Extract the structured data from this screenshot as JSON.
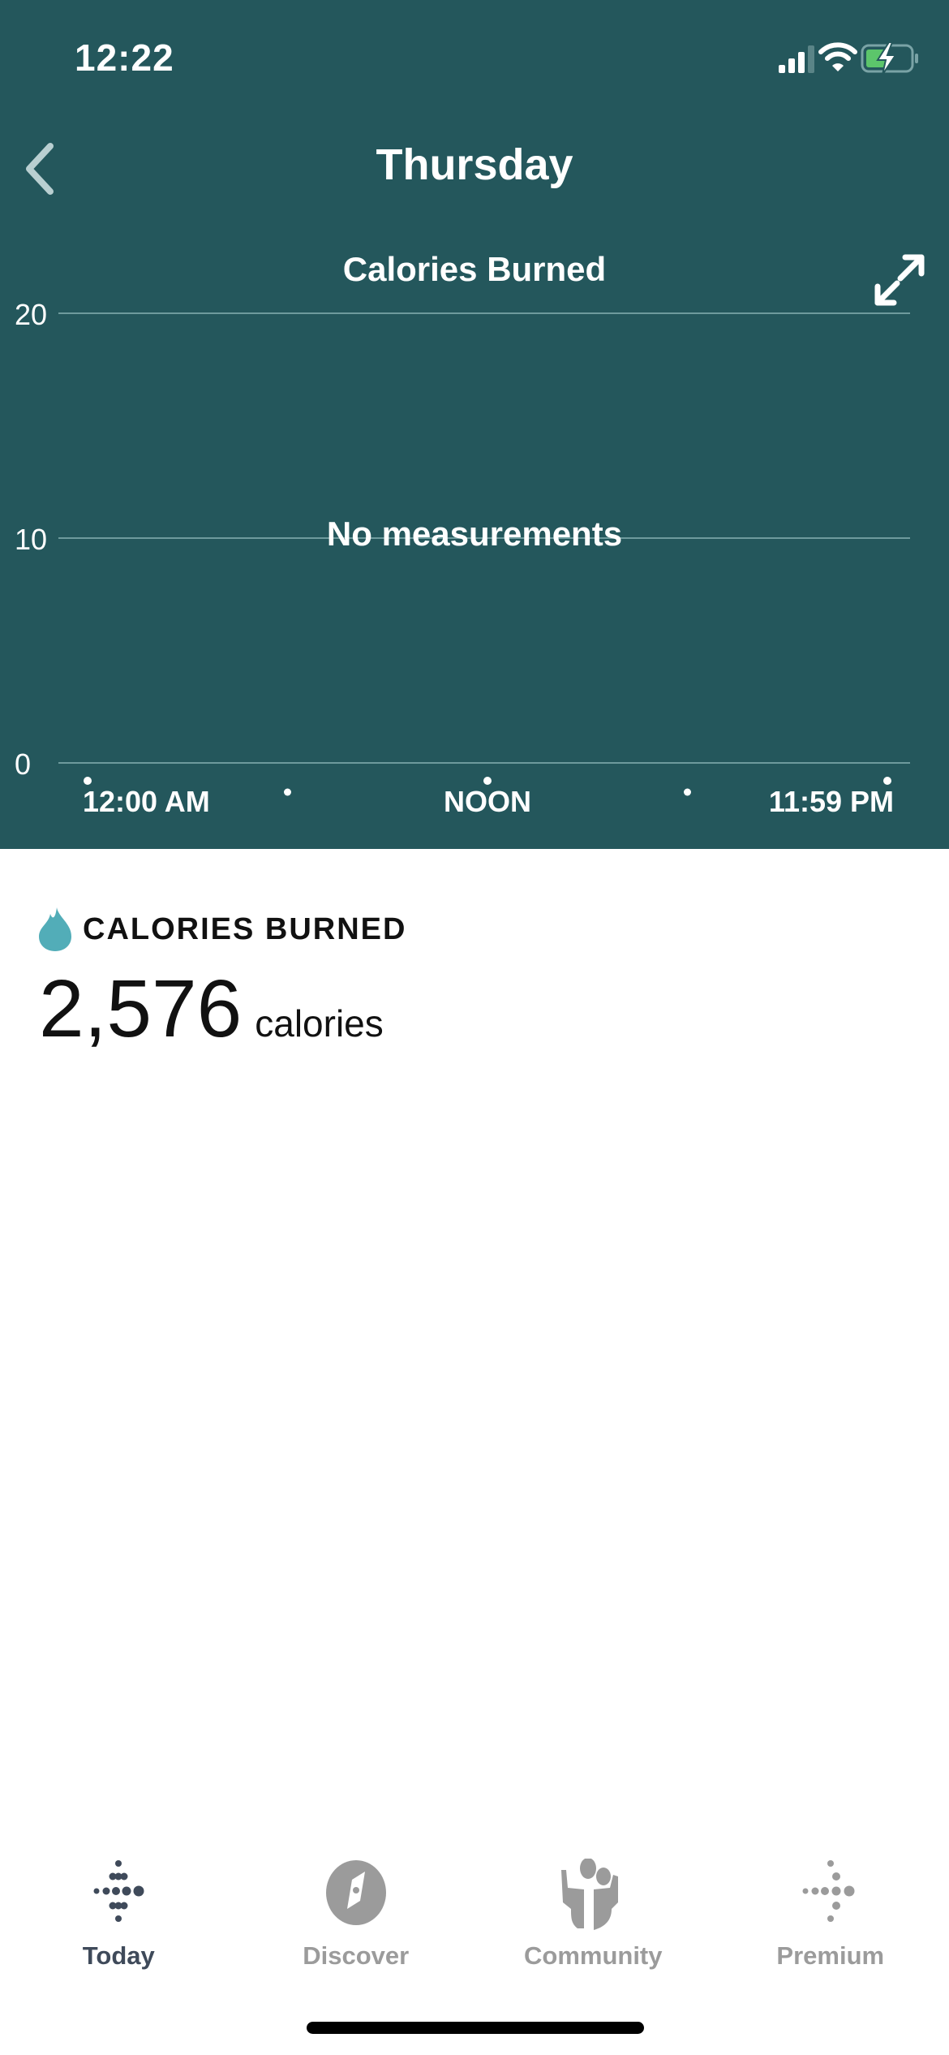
{
  "status_bar": {
    "time": "12:22",
    "signal_bars": 3,
    "signal_bars_total": 4,
    "wifi": "wifi-icon",
    "battery_level_fraction": 0.5,
    "battery_charging": true,
    "battery_color": "#5cc56b"
  },
  "nav": {
    "title": "Thursday",
    "back_icon": "chevron-left-icon"
  },
  "chart_data": {
    "type": "bar",
    "title": "Calories Burned",
    "empty_message": "No measurements",
    "y_ticks": [
      0,
      10,
      20
    ],
    "ylim": [
      0,
      20
    ],
    "x_tick_labels": [
      "12:00 AM",
      "NOON",
      "11:59 PM"
    ],
    "x_marker_hours": [
      0,
      6,
      12,
      18,
      24
    ],
    "xlim_hours": [
      0,
      24
    ],
    "values": [],
    "grid": true,
    "expand_icon": "expand-icon"
  },
  "metric": {
    "icon": "flame-icon",
    "label": "CALORIES BURNED",
    "value": "2,576",
    "unit": "calories",
    "accent_color": "#52adb8"
  },
  "colors": {
    "header_bg": "#24575c",
    "tab_active": "#3f4a5a",
    "tab_inactive": "#9b9b9b"
  },
  "tabs": [
    {
      "label": "Today",
      "icon": "fitbit-logo-icon",
      "active": true
    },
    {
      "label": "Discover",
      "icon": "compass-icon",
      "active": false
    },
    {
      "label": "Community",
      "icon": "community-icon",
      "active": false
    },
    {
      "label": "Premium",
      "icon": "premium-dots-icon",
      "active": false
    }
  ]
}
